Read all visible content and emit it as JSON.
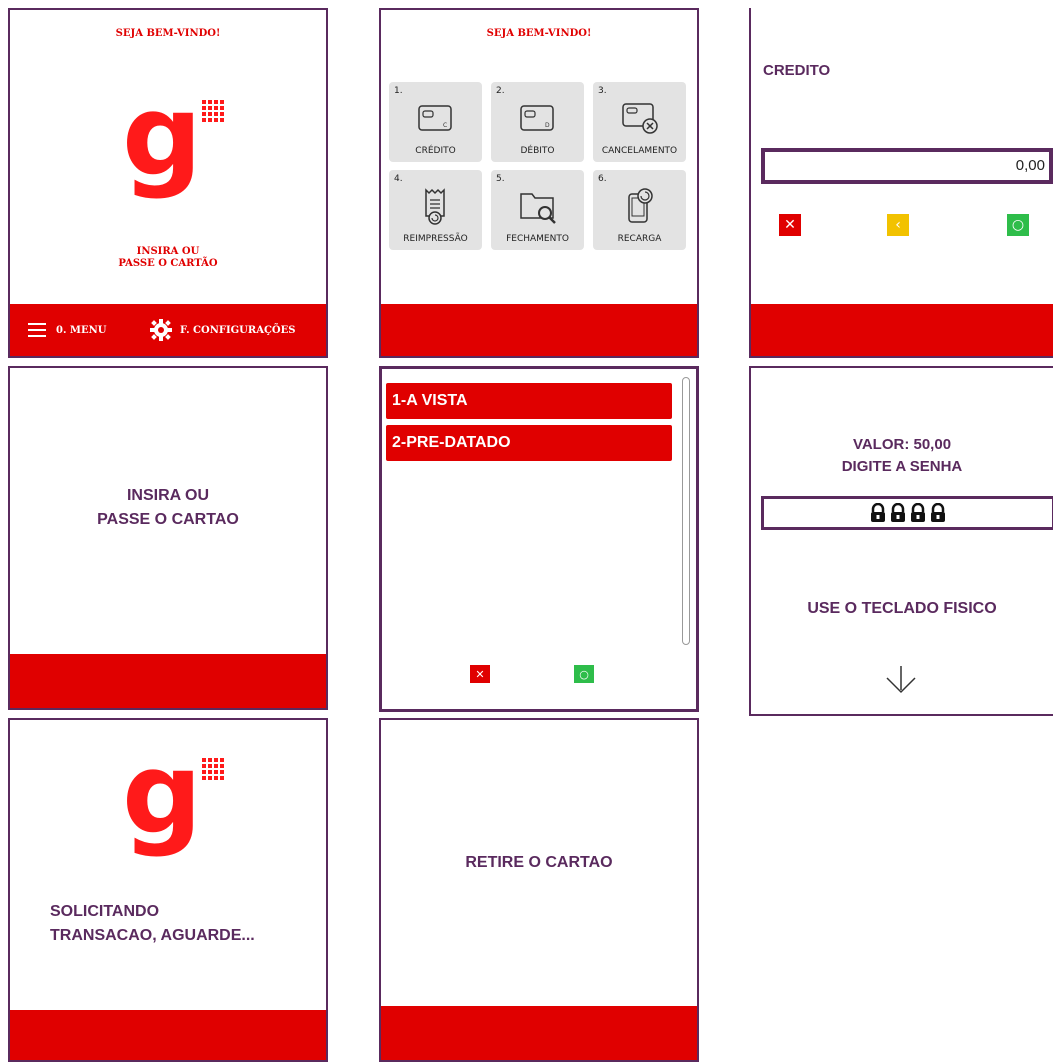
{
  "screen1": {
    "welcome": "SEJA BEM-VINDO!",
    "logo_letter": "g",
    "prompt_line1": "INSIRA OU",
    "prompt_line2": "PASSE O CARTÃO",
    "menu_label": "0. MENU",
    "config_label": "F. CONFIGURAÇÕES",
    "bar_color": "#e00000"
  },
  "screen2": {
    "welcome": "SEJA BEM-VINDO!",
    "tiles": [
      {
        "num": "1.",
        "label": "CRÉDITO",
        "icon": "credit-card-icon"
      },
      {
        "num": "2.",
        "label": "DÉBITO",
        "icon": "debit-card-icon"
      },
      {
        "num": "3.",
        "label": "CANCELAMENTO",
        "icon": "cancel-card-icon"
      },
      {
        "num": "4.",
        "label": "REIMPRESSÃO",
        "icon": "receipt-reprint-icon"
      },
      {
        "num": "5.",
        "label": "FECHAMENTO",
        "icon": "folder-search-icon"
      },
      {
        "num": "6.",
        "label": "RECARGA",
        "icon": "phone-recharge-icon"
      }
    ]
  },
  "screen3": {
    "title": "CREDITO",
    "amount": "0,00"
  },
  "screen4": {
    "line1": "INSIRA OU",
    "line2": "PASSE O CARTAO"
  },
  "screen5": {
    "options": [
      "1-A VISTA",
      "2-PRE-DATADO"
    ]
  },
  "screen6": {
    "value_line": "VALOR: 50,00",
    "instruction": "DIGITE A SENHA",
    "footer": "USE O TECLADO FISICO",
    "pin_digits": 4
  },
  "screen7": {
    "logo_letter": "g",
    "line1": "SOLICITANDO",
    "line2": "TRANSACAO, AGUARDE..."
  },
  "screen8": {
    "message": "RETIRE O CARTAO"
  },
  "colors": {
    "brand_red": "#e00000",
    "text_purple": "#5a2a5e",
    "confirm_green": "#2ebd4a",
    "back_yellow": "#f2c200"
  }
}
